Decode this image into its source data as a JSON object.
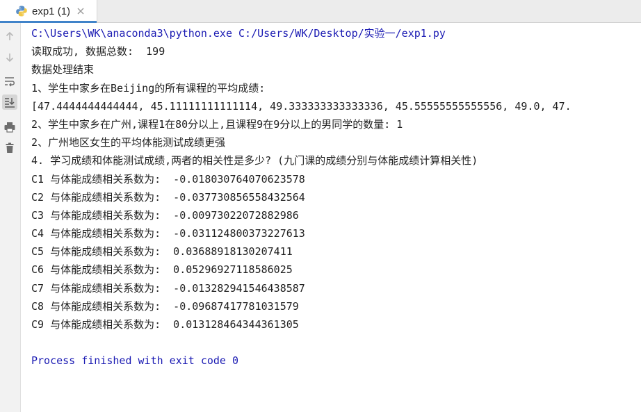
{
  "tab": {
    "label": "exp1 (1)",
    "icon": "python-file-icon",
    "accent_color": "#4083c9"
  },
  "toolbar": {
    "items": [
      {
        "name": "scroll-up-icon"
      },
      {
        "name": "scroll-down-icon"
      },
      {
        "name": "soft-wrap-icon"
      },
      {
        "name": "scroll-to-end-icon"
      },
      {
        "name": "print-icon"
      },
      {
        "name": "delete-icon"
      }
    ]
  },
  "console": {
    "command": "C:\\Users\\WK\\anaconda3\\python.exe C:/Users/WK/Desktop/实验一/exp1.py",
    "lines": [
      "读取成功, 数据总数:  199",
      "数据处理结束",
      "1、学生中家乡在Beijing的所有课程的平均成绩:",
      "[47.4444444444444, 45.11111111111114, 49.333333333333336, 45.55555555555556, 49.0, 47.",
      "2、学生中家乡在广州,课程1在80分以上,且课程9在9分以上的男同学的数量: 1",
      "2、广州地区女生的平均体能测试成绩更强",
      "4. 学习成绩和体能测试成绩,两者的相关性是多少? (九门课的成绩分别与体能成绩计算相关性)",
      "C1 与体能成绩相关系数为:  -0.018030764070623578",
      "C2 与体能成绩相关系数为:  -0.037730856558432564",
      "C3 与体能成绩相关系数为:  -0.00973022072882986",
      "C4 与体能成绩相关系数为:  -0.031124800373227613",
      "C5 与体能成绩相关系数为:  0.03688918130207411",
      "C6 与体能成绩相关系数为:  0.05296927118586025",
      "C7 与体能成绩相关系数为:  -0.013282941546438587",
      "C8 与体能成绩相关系数为:  -0.09687417781031579",
      "C9 与体能成绩相关系数为:  0.013128464344361305"
    ],
    "exit_message": "Process finished with exit code 0",
    "command_color": "#1b1bb3"
  }
}
